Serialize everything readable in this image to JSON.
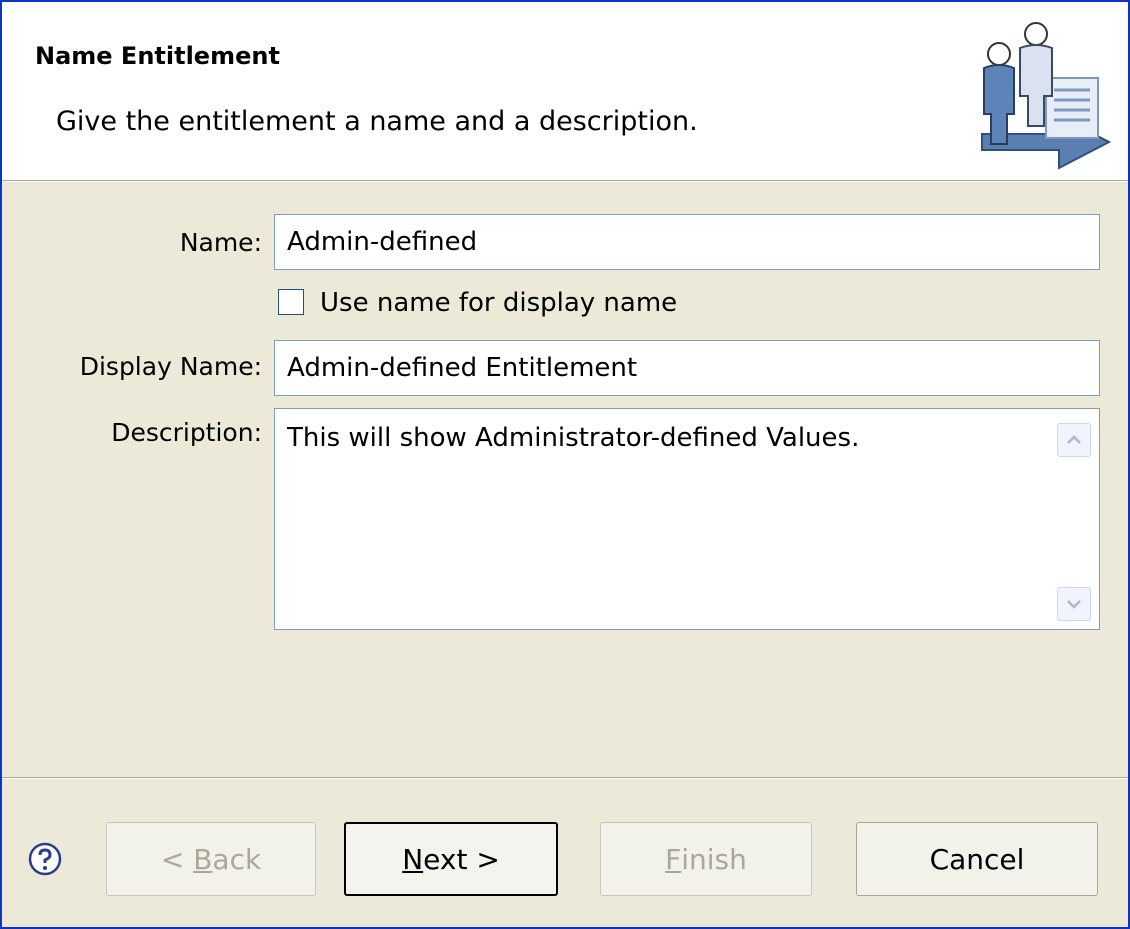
{
  "wizard": {
    "title": "Name Entitlement",
    "description": "Give the entitlement a name and a description.",
    "header_icon": "users-arrow-icon"
  },
  "form": {
    "name_label": "Name:",
    "name_value": "Admin-defined",
    "use_name_checkbox_label": "Use name for display name",
    "use_name_checked": false,
    "display_name_label": "Display Name:",
    "display_name_value": "Admin-defined Entitlement",
    "description_label": "Description:",
    "description_value": "This will show Administrator-defined Values."
  },
  "buttons": {
    "help_icon": "help-icon",
    "back_label_prefix": "< ",
    "back_label_mnemonic": "B",
    "back_label_rest": "ack",
    "next_label_mnemonic": "N",
    "next_label_rest": "ext >",
    "finish_label_mnemonic": "F",
    "finish_label_rest": "inish",
    "cancel_label": "Cancel"
  },
  "colors": {
    "window_border": "#0b35c6",
    "dialog_bg": "#ece9d8",
    "disabled_text": "#aca899"
  }
}
